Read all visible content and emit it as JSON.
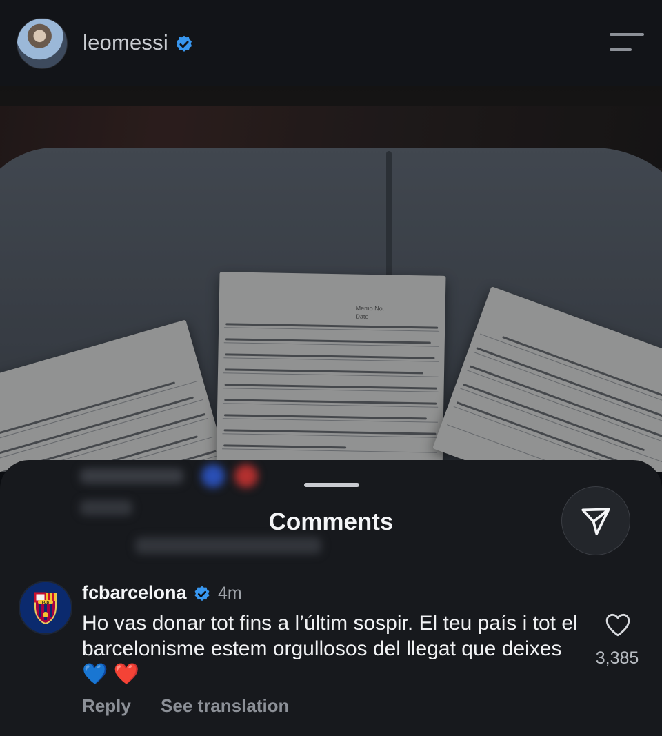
{
  "header": {
    "username": "leomessi",
    "verified_icon": "verified-badge-icon",
    "menu_icon": "menu-icon"
  },
  "post_image": {
    "description_icon": "handwritten-notes-photo"
  },
  "comments_sheet": {
    "title": "Comments",
    "blurred_reply_link": "View 11 more replies",
    "blurred_label": "Reply",
    "send_icon": "send-icon"
  },
  "comment": {
    "username": "fcbarcelona",
    "time": "4m",
    "text": "Ho vas donar tot fins a l’últim sospir. El teu país i tot el barcelonisme estem orgullosos del llegat que deixes 💙 ❤️",
    "like_count": "3,385",
    "reply_label": "Reply",
    "translate_label": "See translation",
    "avatar_badge": "FCB"
  },
  "colors": {
    "verified_blue": "#3897f0",
    "background": "#0b0d11",
    "sheet": "#17191d"
  }
}
